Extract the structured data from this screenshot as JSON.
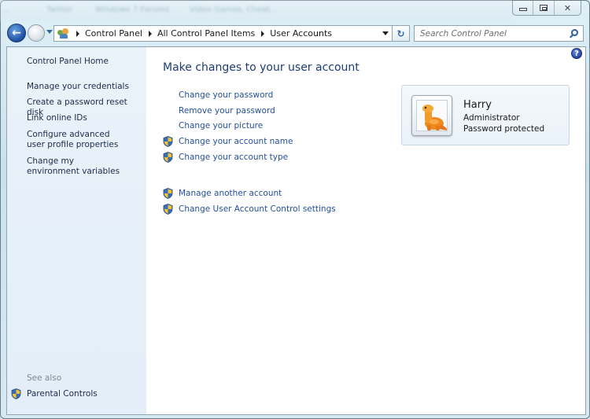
{
  "window": {
    "background_taskbar_items": [
      "...",
      "Twitter",
      "Windows 7 Forums",
      "Video Games, Cheat..."
    ],
    "caption": {
      "minimize_label": "Minimize",
      "maximize_label": "Maximize",
      "close_glyph": "✕"
    }
  },
  "nav": {
    "back_glyph": "←",
    "refresh_glyph": "↻",
    "breadcrumb": [
      "Control Panel",
      "All Control Panel Items",
      "User Accounts"
    ],
    "search_placeholder": "Search Control Panel",
    "search_value": ""
  },
  "sidebar": {
    "home_label": "Control Panel Home",
    "links": [
      "Manage your credentials",
      "Create a password reset disk",
      "Link online IDs",
      "Configure advanced user profile properties",
      "Change my environment variables"
    ],
    "see_also_label": "See also",
    "see_also_links": [
      "Parental Controls"
    ]
  },
  "main": {
    "title": "Make changes to your user account",
    "help_glyph": "?",
    "tasks": [
      {
        "label": "Change your password",
        "shield": false
      },
      {
        "label": "Remove your password",
        "shield": false
      },
      {
        "label": "Change your picture",
        "shield": false
      },
      {
        "label": "Change your account name",
        "shield": true
      },
      {
        "label": "Change your account type",
        "shield": true
      }
    ],
    "other_tasks": [
      {
        "label": "Manage another account",
        "shield": true
      },
      {
        "label": "Change User Account Control settings",
        "shield": true
      }
    ]
  },
  "account": {
    "name": "Harry",
    "type": "Administrator",
    "status": "Password protected",
    "picture": "orange-dinosaur"
  },
  "colors": {
    "link": "#245099",
    "title": "#1e3b74",
    "sidebar_bg": "#e3eef8"
  }
}
